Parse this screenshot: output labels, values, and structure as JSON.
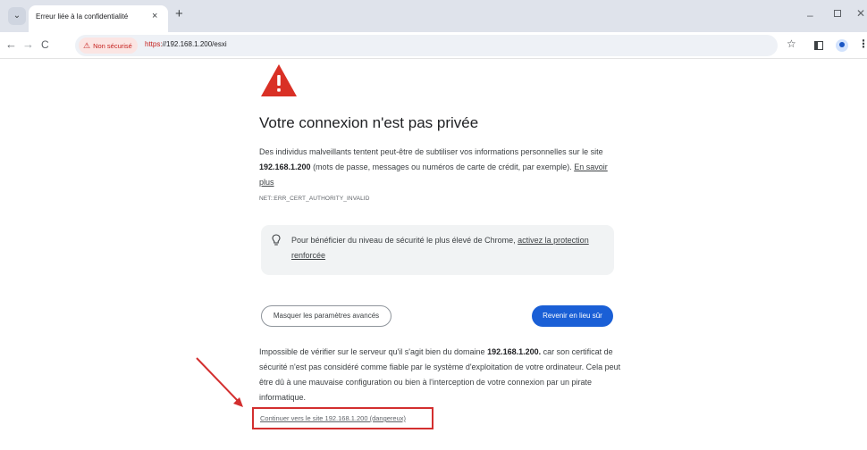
{
  "tab": {
    "title": "Erreur liée à la confidentialité",
    "close_glyph": "×",
    "new_tab_glyph": "+",
    "menu_glyph": "⌄"
  },
  "window": {
    "minimize_glyph": "–",
    "close_glyph": "✕"
  },
  "toolbar": {
    "back_glyph": "←",
    "forward_glyph": "→",
    "reload_glyph": "C",
    "security_label": "Non sécurisé",
    "url_scheme": "https:",
    "url_rest": "//192.168.1.200/esxi",
    "bookmark_glyph": "☆",
    "menu_glyph": "⋮"
  },
  "page": {
    "heading": "Votre connexion n'est pas privée",
    "intro_before": "Des individus malveillants tentent peut-être de subtiliser vos informations personnelles sur le site ",
    "host": "192.168.1.200",
    "intro_after": " (mots de passe, messages ou numéros de carte de crédit, par exemple). ",
    "learn_more": "En savoir plus",
    "error_code": "NET::ERR_CERT_AUTHORITY_INVALID",
    "promo_before": "Pour bénéficier du niveau de sécurité le plus élevé de Chrome, ",
    "promo_link": "activez la protection renforcée",
    "advanced_button": "Masquer les paramètres avancés",
    "back_button": "Revenir en lieu sûr",
    "details_before": "Impossible de vérifier sur le serveur qu'il s'agit bien du domaine ",
    "details_host": "192.168.1.200.",
    "details_after": " car son certificat de sécurité n'est pas considéré comme fiable par le système d'exploitation de votre ordinateur. Cela peut être dû à une mauvaise configuration ou bien à l'interception de votre connexion par un pirate informatique.",
    "proceed_link": "Continuer vers le site 192.168.1.200 (dangereux)"
  },
  "icons": {
    "warning": "warning-triangle-icon",
    "bulb": "lightbulb-icon",
    "annotation": "red-arrow-annotation"
  },
  "colors": {
    "danger": "#d93025",
    "primary_button": "#1a5fd6",
    "annotation": "#d32f2f",
    "promo_background": "#f1f3f4"
  }
}
